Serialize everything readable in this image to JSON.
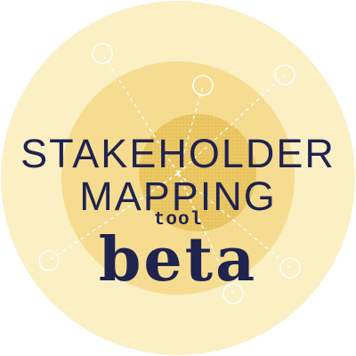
{
  "logo": {
    "title_line_1": "STAKEHOLDER",
    "title_line_2": "MAPPING",
    "subtitle": "tool",
    "badge": "beta"
  },
  "colors": {
    "outer_ring": "#fbefc4",
    "middle_ring": "#f6dc90",
    "inner_circle": "#ebc864",
    "text": "#1f2350",
    "connector": "#ffffff"
  },
  "icons": [
    "stakeholder-node-icon"
  ]
}
